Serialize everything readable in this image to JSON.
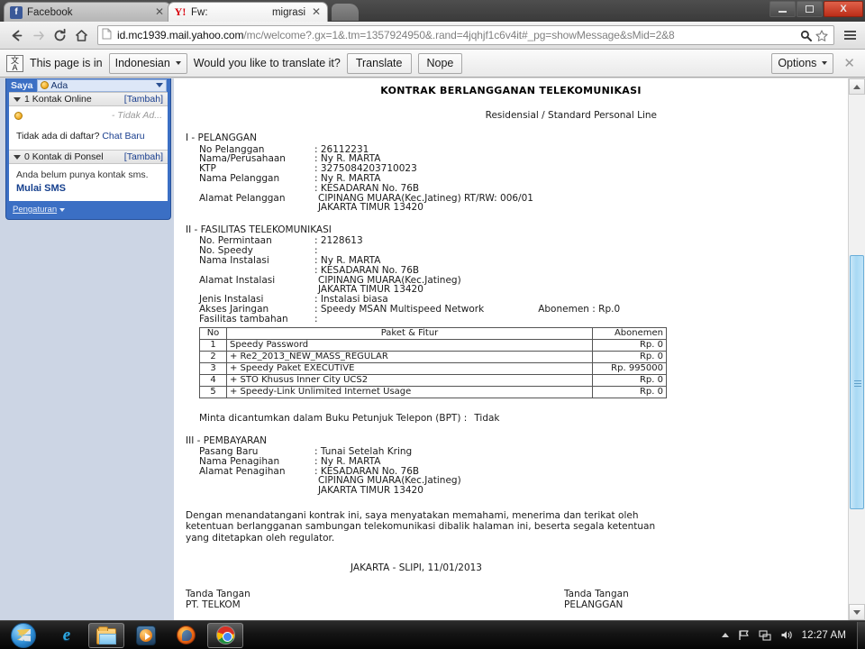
{
  "window": {
    "minimize_label": "Minimize",
    "maximize_label": "Maximize",
    "close_label": "X"
  },
  "tabs": [
    {
      "title": "Facebook",
      "favicon": "facebook-icon",
      "close": "✕",
      "active": false
    },
    {
      "title": "Fw:",
      "title2": "migrasi",
      "favicon": "yahoo-icon",
      "close": "✕",
      "active": true
    }
  ],
  "toolbar": {
    "back_icon": "back-arrow-icon",
    "forward_icon": "forward-arrow-icon",
    "reload_icon": "reload-icon",
    "home_icon": "home-icon",
    "url_bold": "id.mc1939.mail.yahoo.com",
    "url_rest": "/mc/welcome?.gx=1&.tm=1357924950&.rand=4jqhjf1c6v4it#_pg=showMessage&sMid=2&8",
    "search_icon": "search-icon",
    "bookmark_icon": "star-icon",
    "menu_icon": "hamburger-menu-icon"
  },
  "infobar": {
    "icon": "translate-icon",
    "message": "This page is in",
    "language": "Indonesian",
    "question": "Would you like to translate it?",
    "translate_label": "Translate",
    "nope_label": "Nope",
    "options_label": "Options",
    "close_label": "✕"
  },
  "chat": {
    "me_label": "Saya",
    "status": "Ada",
    "online_section": {
      "title": "1 Kontak Online",
      "add": "[Tambah]"
    },
    "online_row": {
      "label": "- Tidak Ad..."
    },
    "not_listed_prefix": "Tidak ada di daftar?",
    "not_listed_link": "Chat Baru",
    "phone_section": {
      "title": "0 Kontak di Ponsel",
      "add": "[Tambah]"
    },
    "no_sms_text": "Anda belum punya kontak sms.",
    "start_sms_link": "Mulai SMS",
    "settings_label": "Pengaturan"
  },
  "document": {
    "title": "KONTRAK BERLANGGANAN TELEKOMUNIKASI",
    "subtitle": "Residensial / Standard Personal Line",
    "section1_heading": "I - PELANGGAN",
    "section1_fields": [
      {
        "label": "No Pelanggan",
        "value": ": 26112231"
      },
      {
        "label": "Nama/Perusahaan",
        "value": ": Ny R. MARTA"
      },
      {
        "label": "KTP",
        "value": ": 3275084203710023"
      },
      {
        "label": "Nama Pelanggan",
        "value": ": Ny R. MARTA"
      }
    ],
    "customer_address_label": "Alamat Pelanggan",
    "customer_address_lines": [
      ": KESADARAN No. 76B",
      "CIPINANG MUARA(Kec.Jatineg) RT/RW: 006/01",
      "JAKARTA TIMUR 13420"
    ],
    "section2_heading": "II - FASILITAS TELEKOMUNIKASI",
    "section2_fields": [
      {
        "label": "No. Permintaan",
        "value": ": 2128613"
      },
      {
        "label": "No. Speedy",
        "value": ":"
      },
      {
        "label": "Nama Instalasi",
        "value": ": Ny R. MARTA"
      }
    ],
    "install_address_label": "Alamat Instalasi",
    "install_address_lines": [
      ": KESADARAN No. 76B",
      "CIPINANG MUARA(Kec.Jatineg)",
      "JAKARTA TIMUR 13420"
    ],
    "section2_fields_b": [
      {
        "label": "Jenis Instalasi",
        "value": ": Instalasi biasa"
      }
    ],
    "akses_label": "Akses Jaringan",
    "akses_value": ": Speedy MSAN Multispeed Network",
    "akses_extra": "Abonemen : Rp.0",
    "fasilitas_label": "Fasilitas tambahan",
    "fasilitas_value": ":",
    "table": {
      "headers": [
        "No",
        "Paket & Fitur",
        "Abonemen"
      ],
      "rows": [
        {
          "no": "1",
          "feature": "Speedy Password",
          "fee": "Rp. 0"
        },
        {
          "no": "2",
          "feature": "+ Re2_2013_NEW_MASS_REGULAR",
          "fee": "Rp. 0"
        },
        {
          "no": "3",
          "feature": "+ Speedy Paket EXECUTIVE",
          "fee": "Rp. 995000"
        },
        {
          "no": "4",
          "feature": "+ STO Khusus Inner City UCS2",
          "fee": "Rp. 0"
        },
        {
          "no": "5",
          "feature": "+ Speedy-Link Unlimited Internet Usage",
          "fee": "Rp. 0"
        }
      ]
    },
    "bpt_label": "Minta dicantumkan dalam Buku Petunjuk Telepon (BPT)  :",
    "bpt_value": "Tidak",
    "section3_heading": "III - PEMBAYARAN",
    "section3_fields": [
      {
        "label": "Pasang Baru",
        "value": ": Tunai Setelah Kring"
      },
      {
        "label": "Nama Penagihan",
        "value": ": Ny R. MARTA"
      }
    ],
    "billing_address_label": "Alamat Penagihan",
    "billing_address_lines": [
      ": KESADARAN No. 76B",
      "CIPINANG MUARA(Kec.Jatineg)",
      "JAKARTA TIMUR 13420"
    ],
    "paragraph_line1": "Dengan menandatangani kontrak ini, saya menyatakan memahami, menerima dan terikat oleh",
    "paragraph_line2": "ketentuan berlangganan sambungan telekomunikasi dibalik halaman ini, beserta segala ketentuan",
    "paragraph_line3": "yang ditetapkan oleh regulator.",
    "place_date": "JAKARTA - SLIPI, 11/01/2013",
    "sign_left_line1": "Tanda Tangan",
    "sign_left_line2": "PT. TELKOM",
    "sign_right_line1": "Tanda Tangan",
    "sign_right_line2": "PELANGGAN"
  },
  "scrollbar": {
    "up_icon": "scroll-up-arrow-icon",
    "down_icon": "scroll-down-arrow-icon",
    "thumb_color": "#a9d9f4"
  },
  "taskbar": {
    "start_label": "start-orb-icon",
    "items": [
      {
        "name": "internet-explorer",
        "icon": "internet-explorer-icon"
      },
      {
        "name": "windows-explorer",
        "icon": "folder-icon"
      },
      {
        "name": "windows-media-player",
        "icon": "media-player-icon"
      },
      {
        "name": "firefox",
        "icon": "firefox-icon"
      },
      {
        "name": "google-chrome",
        "icon": "chrome-icon"
      }
    ],
    "tray": {
      "show_hidden_icon": "chevron-up-icon",
      "action_center_icon": "flag-icon",
      "network_icon": "network-icon",
      "volume_icon": "speaker-icon",
      "clock": "12:27 AM"
    }
  }
}
